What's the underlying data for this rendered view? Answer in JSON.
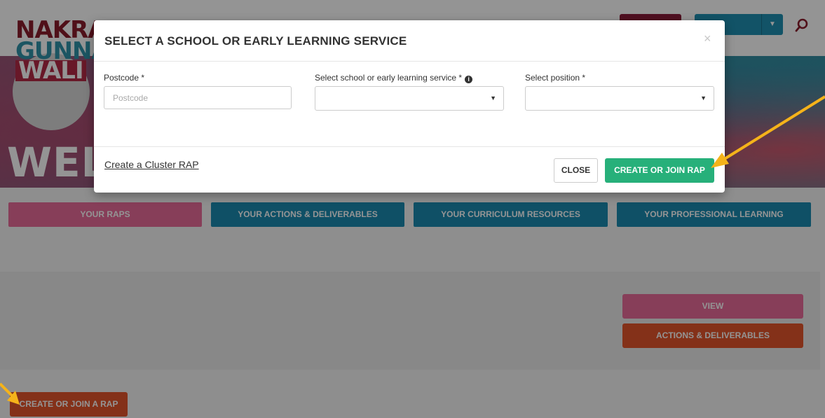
{
  "hero": {
    "logo_line1": "NAKRA",
    "logo_line2": "GUNNA",
    "logo_line3": "WALI",
    "title": "WELC"
  },
  "nav": {
    "your_raps": "YOUR RAPS",
    "actions_deliverables": "YOUR ACTIONS & DELIVERABLES",
    "curriculum_resources": "YOUR CURRICULUM RESOURCES",
    "professional_learning": "YOUR PROFESSIONAL LEARNING"
  },
  "panel": {
    "view": "VIEW",
    "actions_deliverables": "ACTIONS & DELIVERABLES"
  },
  "page": {
    "create_or_join_a_rap": "CREATE OR JOIN A RAP"
  },
  "modal": {
    "title": "SELECT A SCHOOL OR EARLY LEARNING SERVICE",
    "close_symbol": "×",
    "postcode_label": "Postcode *",
    "postcode_placeholder": "Postcode",
    "school_label": "Select school or early learning service *",
    "position_label": "Select position *",
    "cluster_link": "Create a Cluster RAP",
    "close_button": "CLOSE",
    "create_join_button": "CREATE OR JOIN RAP"
  },
  "colors": {
    "pink": "#e86b99",
    "blue": "#1a8ab0",
    "orange": "#e4552b",
    "green": "#27b07a",
    "arrow": "#f5b31a"
  },
  "icons": {
    "search": "search-icon",
    "info": "info-icon",
    "caret": "caret-down-icon",
    "close": "close-icon"
  }
}
